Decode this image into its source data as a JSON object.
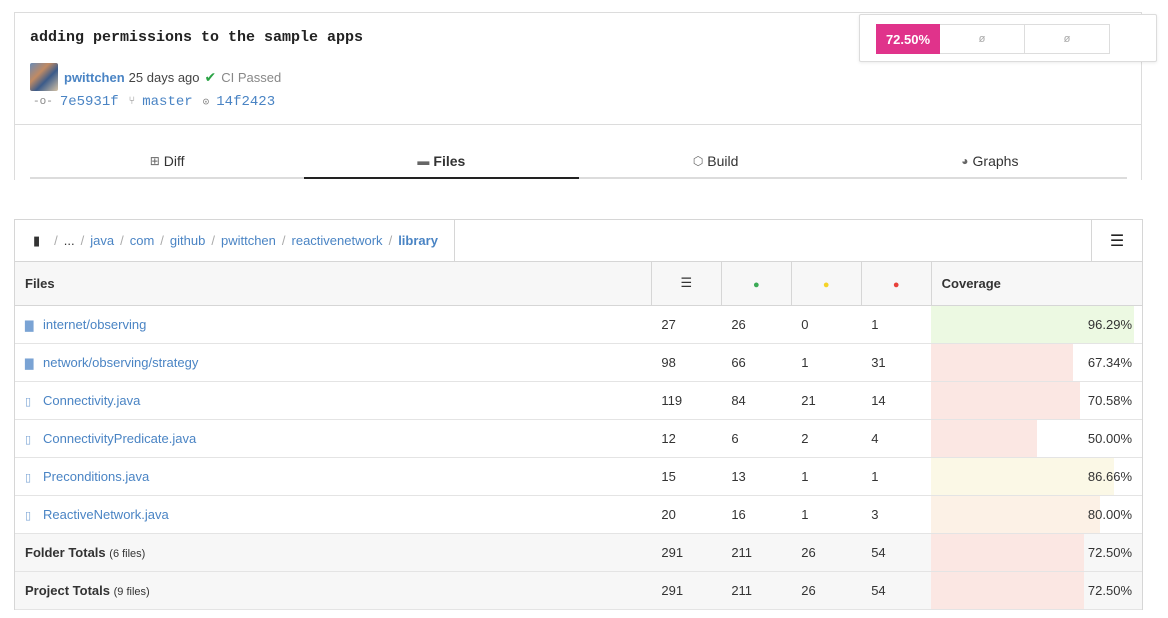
{
  "commit": {
    "title": "adding permissions to the sample apps",
    "author": "pwittchen",
    "ago": "25 days ago",
    "check_icon": "check-icon",
    "ci_status": "CI Passed",
    "sha": "7e5931f",
    "branch": "master",
    "parent": "14f2423"
  },
  "coverage_summary": {
    "value": "72.50%",
    "cell2": "ø",
    "cell3": "ø",
    "accent": "#e0338b"
  },
  "tabs": [
    {
      "label": "Diff",
      "icon": "diff-icon",
      "active": false
    },
    {
      "label": "Files",
      "icon": "folder-icon",
      "active": true
    },
    {
      "label": "Build",
      "icon": "build-icon",
      "active": false
    },
    {
      "label": "Graphs",
      "icon": "pie-chart-icon",
      "active": false
    }
  ],
  "breadcrumb": [
    "...",
    "java",
    "com",
    "github",
    "pwittchen",
    "reactivenetwork",
    "library"
  ],
  "table": {
    "headers": {
      "files": "Files",
      "lines_icon": "lines-icon",
      "hit_color": "#3aaa55",
      "partial_color": "#f5d327",
      "miss_color": "#e8413a",
      "coverage": "Coverage"
    },
    "rows": [
      {
        "name": "internet/observing",
        "type": "folder",
        "lines": "27",
        "hits": "26",
        "partials": "0",
        "misses": "1",
        "coverage": "96.29%",
        "pct": 96.29,
        "bar_color": "#ecf9e2"
      },
      {
        "name": "network/observing/strategy",
        "type": "folder",
        "lines": "98",
        "hits": "66",
        "partials": "1",
        "misses": "31",
        "coverage": "67.34%",
        "pct": 67.34,
        "bar_color": "#fbe7e3"
      },
      {
        "name": "Connectivity.java",
        "type": "file",
        "lines": "119",
        "hits": "84",
        "partials": "21",
        "misses": "14",
        "coverage": "70.58%",
        "pct": 70.58,
        "bar_color": "#fbe7e3"
      },
      {
        "name": "ConnectivityPredicate.java",
        "type": "file",
        "lines": "12",
        "hits": "6",
        "partials": "2",
        "misses": "4",
        "coverage": "50.00%",
        "pct": 50.0,
        "bar_color": "#fbe7e3"
      },
      {
        "name": "Preconditions.java",
        "type": "file",
        "lines": "15",
        "hits": "13",
        "partials": "1",
        "misses": "1",
        "coverage": "86.66%",
        "pct": 86.66,
        "bar_color": "#fbf8e6"
      },
      {
        "name": "ReactiveNetwork.java",
        "type": "file",
        "lines": "20",
        "hits": "16",
        "partials": "1",
        "misses": "3",
        "coverage": "80.00%",
        "pct": 80.0,
        "bar_color": "#fcf1e6"
      }
    ],
    "totals": [
      {
        "label": "Folder Totals",
        "count": "(6 files)",
        "lines": "291",
        "hits": "211",
        "partials": "26",
        "misses": "54",
        "coverage": "72.50%",
        "pct": 72.5,
        "bar_color": "#fbe7e3"
      },
      {
        "label": "Project Totals",
        "count": "(9 files)",
        "lines": "291",
        "hits": "211",
        "partials": "26",
        "misses": "54",
        "coverage": "72.50%",
        "pct": 72.5,
        "bar_color": "#fbe7e3"
      }
    ]
  }
}
